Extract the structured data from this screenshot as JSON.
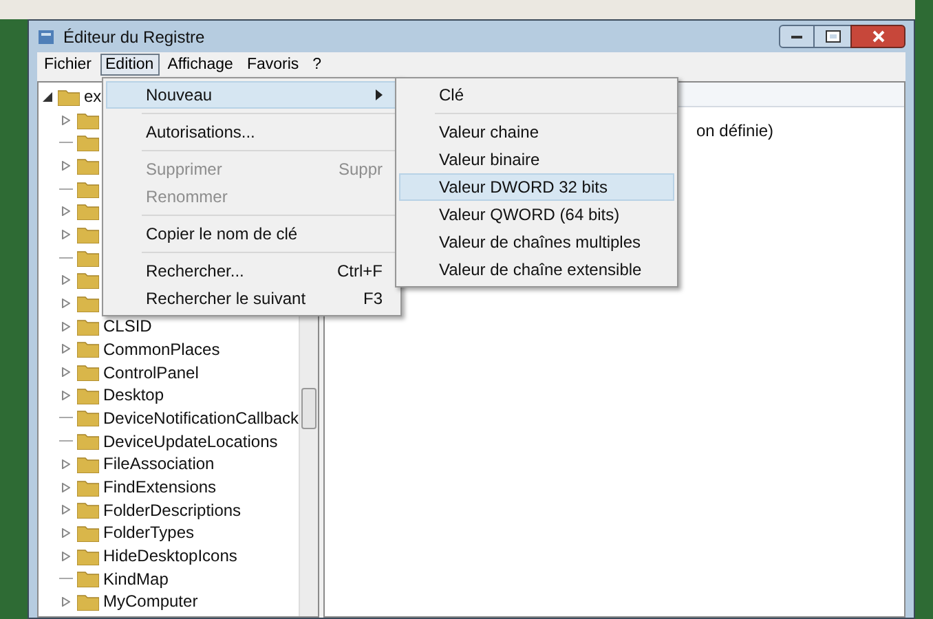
{
  "window": {
    "title": "Éditeur du Registre"
  },
  "menu_bar": [
    {
      "label": "Fichier",
      "selected": false
    },
    {
      "label": "Edition",
      "selected": true
    },
    {
      "label": "Affichage",
      "selected": false
    },
    {
      "label": "Favoris",
      "selected": false
    },
    {
      "label": "?",
      "selected": false
    }
  ],
  "tree": {
    "name": "ex",
    "expanded": true,
    "children": [
      {
        "expandable": true
      },
      {
        "expandable": false
      },
      {
        "expandable": true
      },
      {
        "expandable": false
      },
      {
        "expandable": true
      },
      {
        "expandable": true
      },
      {
        "expandable": false
      },
      {
        "expandable": true
      },
      {
        "expandable": true
      },
      {
        "name": "CLSID",
        "expandable": true
      },
      {
        "name": "CommonPlaces",
        "expandable": true
      },
      {
        "name": "ControlPanel",
        "expandable": true
      },
      {
        "name": "Desktop",
        "expandable": true
      },
      {
        "name": "DeviceNotificationCallback",
        "expandable": false
      },
      {
        "name": "DeviceUpdateLocations",
        "expandable": false
      },
      {
        "name": "FileAssociation",
        "expandable": true
      },
      {
        "name": "FindExtensions",
        "expandable": true
      },
      {
        "name": "FolderDescriptions",
        "expandable": true
      },
      {
        "name": "FolderTypes",
        "expandable": true
      },
      {
        "name": "HideDesktopIcons",
        "expandable": true
      },
      {
        "name": "KindMap",
        "expandable": false
      },
      {
        "name": "MyComputer",
        "expandable": true
      }
    ]
  },
  "values_pane": {
    "row_1_data": "on définie)"
  },
  "edit_menu": [
    {
      "kind": "item",
      "label": "Nouveau",
      "submenu": true,
      "selected": true,
      "disabled": false
    },
    {
      "kind": "separator"
    },
    {
      "kind": "item",
      "label": "Autorisations...",
      "selected": false,
      "disabled": false
    },
    {
      "kind": "separator"
    },
    {
      "kind": "item",
      "label": "Supprimer",
      "shortcut": "Suppr",
      "selected": false,
      "disabled": true
    },
    {
      "kind": "item",
      "label": "Renommer",
      "selected": false,
      "disabled": true
    },
    {
      "kind": "separator"
    },
    {
      "kind": "item",
      "label": "Copier le nom de clé",
      "selected": false,
      "disabled": false
    },
    {
      "kind": "separator"
    },
    {
      "kind": "item",
      "label": "Rechercher...",
      "shortcut": "Ctrl+F",
      "selected": false,
      "disabled": false
    },
    {
      "kind": "item",
      "label": "Rechercher le suivant",
      "shortcut": "F3",
      "selected": false,
      "disabled": false
    }
  ],
  "new_submenu": [
    {
      "kind": "item",
      "label": "Clé",
      "selected": false
    },
    {
      "kind": "separator"
    },
    {
      "kind": "item",
      "label": "Valeur chaine",
      "selected": false
    },
    {
      "kind": "item",
      "label": "Valeur binaire",
      "selected": false
    },
    {
      "kind": "item",
      "label": "Valeur DWORD 32 bits",
      "selected": true
    },
    {
      "kind": "item",
      "label": "Valeur QWORD (64 bits)",
      "selected": false
    },
    {
      "kind": "item",
      "label": "Valeur de chaînes multiples",
      "selected": false
    },
    {
      "kind": "item",
      "label": "Valeur de chaîne extensible",
      "selected": false
    }
  ]
}
